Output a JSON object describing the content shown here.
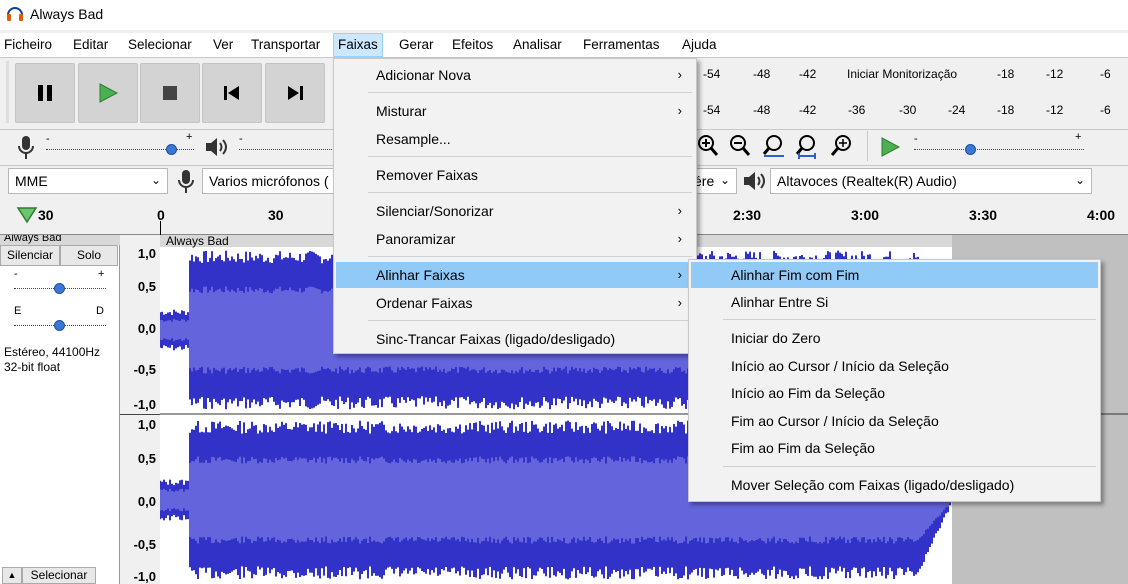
{
  "window": {
    "title": "Always Bad"
  },
  "menubar": [
    "Ficheiro",
    "Editar",
    "Selecionar",
    "Ver",
    "Transportar",
    "Faixas",
    "Gerar",
    "Efeitos",
    "Analisar",
    "Ferramentas",
    "Ajuda"
  ],
  "meter": {
    "top_scale": [
      "-54",
      "-48",
      "-42",
      "Iniciar Monitorização",
      "-18",
      "-12",
      "-6"
    ],
    "bottom_scale": [
      "-54",
      "-48",
      "-42",
      "-36",
      "-30",
      "-24",
      "-18",
      "-12",
      "-6"
    ]
  },
  "devices": {
    "host": "MME",
    "input": "Varios micrófonos (",
    "channels": "ére",
    "output": "Altavoces (Realtek(R) Audio)"
  },
  "volume": {
    "min": "-",
    "max": "+"
  },
  "ruler": [
    "30",
    "0",
    "30",
    "2:30",
    "3:00",
    "3:30",
    "4:00"
  ],
  "track": {
    "name": "Always Bad",
    "mute": "Silenciar",
    "solo": "Solo",
    "gain_min": "-",
    "gain_max": "+",
    "pan_left": "E",
    "pan_right": "D",
    "info1": "Estéreo, 44100Hz",
    "info2": "32-bit float",
    "select": "Selecionar",
    "collapse": "▲",
    "clip_label": "Always Bad"
  },
  "scale_upper": [
    "1,0",
    "0,5",
    "0,0",
    "-0,5",
    "-1,0"
  ],
  "scale_lower": [
    "1,0",
    "0,5",
    "0,0",
    "-0,5",
    "-1,0"
  ],
  "faixas_menu": {
    "items": [
      "Adicionar Nova",
      "Misturar",
      "Resample...",
      "Remover Faixas",
      "Silenciar/Sonorizar",
      "Panoramizar",
      "Alinhar Faixas",
      "Ordenar Faixas",
      "Sinc-Trancar Faixas (ligado/desligado)"
    ]
  },
  "alinhar_menu": {
    "items": [
      "Alinhar Fim com Fim",
      "Alinhar Entre Si",
      "Iniciar do Zero",
      "Início ao Cursor / Início da Seleção",
      "Início ao Fim da Seleção",
      "Fim ao Cursor / Início da Seleção",
      "Fim ao Fim da Seleção",
      "Mover Seleção com Faixas (ligado/desligado)"
    ]
  },
  "colors": {
    "wave": "#3232c8",
    "wave_rms": "#6464dc",
    "highlight": "#91c9f7",
    "menu_active": "#cce8ff"
  }
}
